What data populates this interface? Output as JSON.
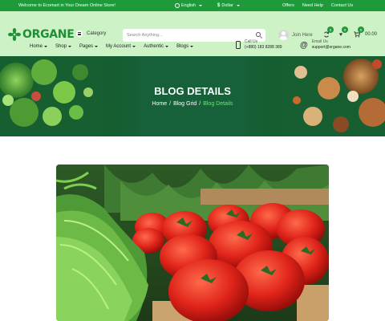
{
  "topbar": {
    "welcome": "Welcome to Ecomart in Your Dream Online Store!",
    "language": "English",
    "currency": "Dollar",
    "links": [
      "Offers",
      "Need Help",
      "Contact Us"
    ]
  },
  "header": {
    "logo_text": "ORGANE",
    "category_label": "Category",
    "search_placeholder": "Search Anything...",
    "user_label": "Join Here",
    "badges": {
      "compare": "0",
      "wishlist": "0",
      "cart": "0"
    },
    "cart_total": "00.00"
  },
  "nav": {
    "items": [
      "Home",
      "Shop",
      "Pages",
      "My Account",
      "Authentic",
      "Blogs"
    ]
  },
  "contact": {
    "call_label": "Call Us",
    "phone": "(+880) 183 8288 389",
    "email_label": "Email Us",
    "email": "support@organe.com"
  },
  "banner": {
    "title": "BLOG DETAILS",
    "breadcrumb": [
      "Home",
      "Blog Grid",
      "Blog Details"
    ]
  },
  "icons": [
    "globe-icon",
    "dollar-icon",
    "menu-icon",
    "search-icon",
    "user-icon",
    "compare-icon",
    "heart-icon",
    "cart-icon",
    "phone-icon",
    "email-icon"
  ],
  "colors": {
    "primary": "#1f9a3a",
    "header_bg": "#ccf2c6",
    "banner_bg": "#14592c",
    "accent": "#6fe07e"
  }
}
